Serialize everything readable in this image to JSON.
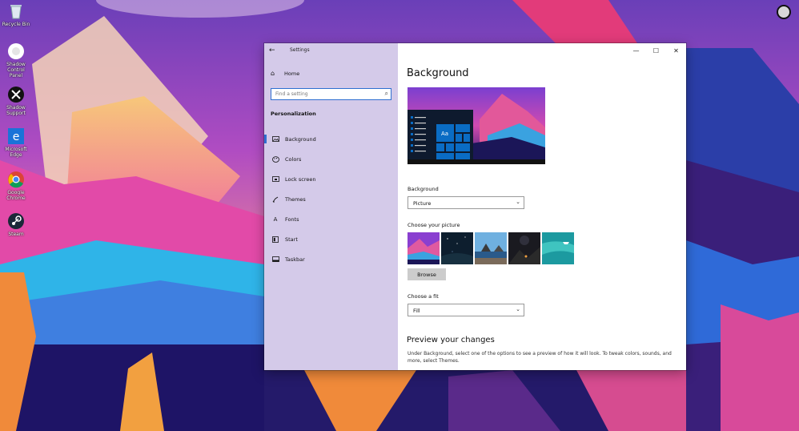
{
  "desktop": {
    "icons": [
      {
        "label": "Recycle Bin",
        "icon": "recycle-bin-icon"
      },
      {
        "label": "Shadow Control Panel",
        "icon": "shadow-icon"
      },
      {
        "label": "Shadow Support",
        "icon": "support-icon"
      },
      {
        "label": "Microsoft Edge",
        "icon": "edge-icon"
      },
      {
        "label": "Google Chrome",
        "icon": "chrome-icon"
      },
      {
        "label": "Steam",
        "icon": "steam-icon"
      }
    ]
  },
  "window": {
    "title": "Settings",
    "controls": {
      "minimize": "—",
      "maximize": "☐",
      "close": "✕"
    }
  },
  "sidebar": {
    "home": "Home",
    "search_placeholder": "Find a setting",
    "section": "Personalization",
    "items": [
      {
        "label": "Background",
        "icon": "picture-icon",
        "active": true
      },
      {
        "label": "Colors",
        "icon": "palette-icon",
        "active": false
      },
      {
        "label": "Lock screen",
        "icon": "lock-screen-icon",
        "active": false
      },
      {
        "label": "Themes",
        "icon": "themes-icon",
        "active": false
      },
      {
        "label": "Fonts",
        "icon": "fonts-icon",
        "active": false
      },
      {
        "label": "Start",
        "icon": "start-icon",
        "active": false
      },
      {
        "label": "Taskbar",
        "icon": "taskbar-icon",
        "active": false
      }
    ]
  },
  "main": {
    "title": "Background",
    "preview_sample_text": "Aa",
    "background_label": "Background",
    "background_value": "Picture",
    "choose_picture_label": "Choose your picture",
    "browse_label": "Browse",
    "fit_label": "Choose a fit",
    "fit_value": "Fill",
    "preview_title": "Preview your changes",
    "preview_desc": "Under Background, select one of the options to see a preview of how it will look. To tweak colors, sounds, and more, select Themes."
  },
  "colors": {
    "accent": "#2f6fd0",
    "start_blue": "#0a6cc4"
  }
}
